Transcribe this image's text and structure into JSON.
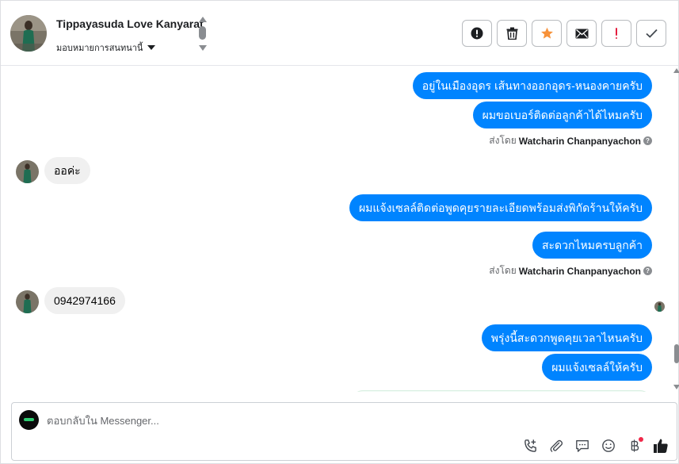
{
  "header": {
    "contact_name": "Tippayasuda Love Kanyarat",
    "assign_label": "มอบหมายการสนทนานี้",
    "actions": [
      {
        "name": "mark-spam-button",
        "icon": "alert-circle-icon"
      },
      {
        "name": "delete-button",
        "icon": "trash-icon"
      },
      {
        "name": "star-button",
        "icon": "star-icon",
        "color": "#f7923a"
      },
      {
        "name": "mark-unread-button",
        "icon": "envelope-icon"
      },
      {
        "name": "follow-up-button",
        "icon": "exclamation-icon",
        "color": "#e41e3f"
      },
      {
        "name": "mark-done-button",
        "icon": "checkmark-icon"
      }
    ]
  },
  "messages": [
    {
      "side": "out",
      "text": "อยู่ในเมืองอุดร เส้นทางออกอุดร-หนองคายครับ"
    },
    {
      "side": "out",
      "text": "ผมขอเบอร์ติดต่อลูกค้าได้ไหมครับ"
    },
    {
      "side": "out",
      "text": "ผมแจ้งเซลล์ติดต่อพูดคุยรายละเอียดพร้อมส่งพิกัดร้านให้ครับ"
    },
    {
      "side": "out",
      "text": "สะดวกไหมครบลูกค้า"
    },
    {
      "side": "out",
      "text": "พรุ่งนี้สะดวกพูดคุยเวลาไหนครับ"
    },
    {
      "side": "out",
      "text": "ผมแจ้งเซลล์ให้ครับ"
    },
    {
      "side": "in",
      "text": "ออค่ะ"
    },
    {
      "side": "in",
      "text": "0942974166"
    }
  ],
  "sent_by": {
    "prefix": "ส่งโดย",
    "agent_name": "Watcharin Chanpanyachon"
  },
  "composer": {
    "placeholder": "ตอบกลับใน Messenger..."
  },
  "colors": {
    "outgoing_bubble": "#0084ff",
    "incoming_bubble": "#f0f0f0",
    "notification_dot": "#f02849"
  }
}
